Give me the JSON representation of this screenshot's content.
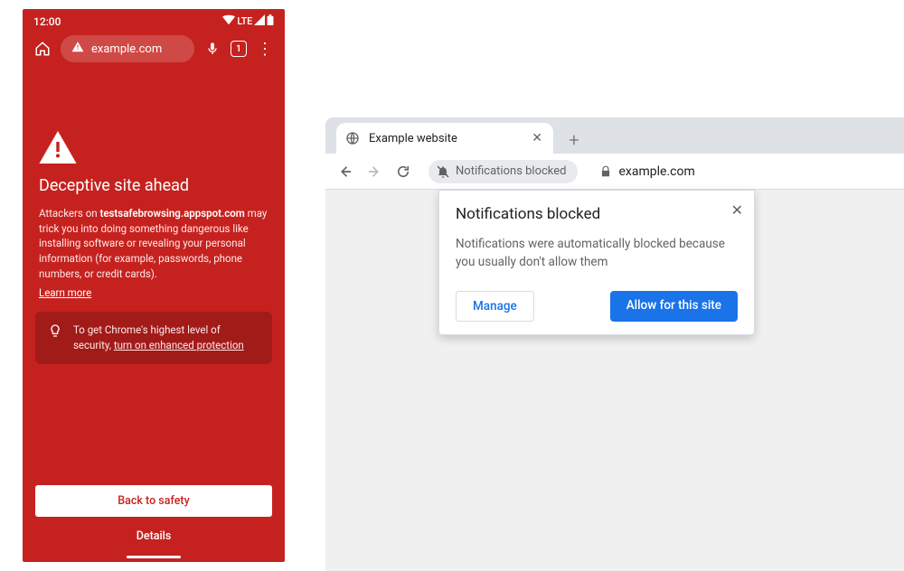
{
  "mobile": {
    "statusbar": {
      "time": "12:00",
      "lte": "LTE"
    },
    "omnibox": {
      "url": "example.com",
      "tab_count": "1"
    },
    "headline": "Deceptive site ahead",
    "body_prefix": "Attackers on ",
    "body_domain": "testsafebrowsing.appspot.com",
    "body_suffix": " may trick you into doing something dangerous like installing software or revealing your personal information (for example, passwords, phone numbers, or credit cards).",
    "learn_more": "Learn more",
    "tip_prefix": "To get Chrome's highest level of security, ",
    "tip_link": "turn on enhanced protection",
    "back_to_safety": "Back to safety",
    "details": "Details"
  },
  "desktop": {
    "tab_title": "Example website",
    "chip_label": "Notifications blocked",
    "address": "example.com",
    "popover": {
      "title": "Notifications blocked",
      "body": "Notifications were automatically blocked because you usually don't allow them",
      "manage": "Manage",
      "allow": "Allow for this site"
    }
  }
}
